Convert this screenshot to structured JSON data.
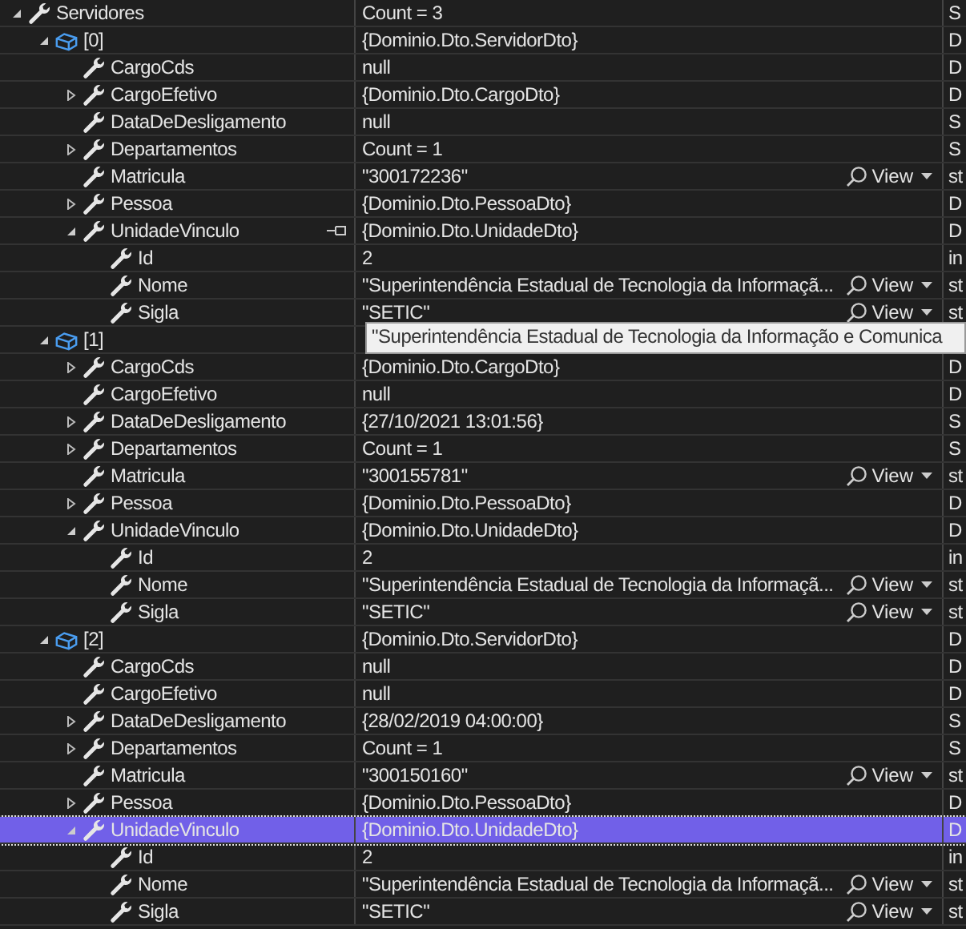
{
  "rows": [
    {
      "name": "Servidores",
      "kind": "property",
      "expanded": true,
      "selected": false,
      "value": "Count = 3",
      "type": "S",
      "children": [
        {
          "name": "[0]",
          "kind": "object",
          "expanded": true,
          "selected": false,
          "value": "{Dominio.Dto.ServidorDto}",
          "type": "D",
          "children": [
            {
              "name": "CargoCds",
              "kind": "property",
              "selected": false,
              "value": "null",
              "type": "D"
            },
            {
              "name": "CargoEfetivo",
              "kind": "property",
              "expanded": false,
              "selected": false,
              "value": "{Dominio.Dto.CargoDto}",
              "type": "D"
            },
            {
              "name": "DataDeDesligamento",
              "kind": "property",
              "selected": false,
              "value": "null",
              "type": "S"
            },
            {
              "name": "Departamentos",
              "kind": "property",
              "expanded": false,
              "selected": false,
              "value": "Count = 1",
              "type": "S"
            },
            {
              "name": "Matricula",
              "kind": "property",
              "selected": false,
              "value": "\"300172236\"",
              "view": "View",
              "type": "st"
            },
            {
              "name": "Pessoa",
              "kind": "property",
              "expanded": false,
              "selected": false,
              "value": "{Dominio.Dto.PessoaDto}",
              "type": "D"
            },
            {
              "name": "UnidadeVinculo",
              "kind": "property",
              "expanded": true,
              "pinned": true,
              "selected": false,
              "value": "{Dominio.Dto.UnidadeDto}",
              "type": "D",
              "children": [
                {
                  "name": "Id",
                  "kind": "property",
                  "selected": false,
                  "value": "2",
                  "type": "in"
                },
                {
                  "name": "Nome",
                  "kind": "property",
                  "selected": false,
                  "value": "\"Superintendência Estadual de Tecnologia da Informaçã...",
                  "view": "View",
                  "type": "st"
                },
                {
                  "name": "Sigla",
                  "kind": "property",
                  "selected": false,
                  "value": "\"SETIC\"",
                  "view": "View",
                  "type": "st"
                }
              ]
            }
          ]
        },
        {
          "name": "[1]",
          "kind": "object",
          "expanded": true,
          "selected": false,
          "children": [
            {
              "name": "CargoCds",
              "kind": "property",
              "expanded": false,
              "selected": false,
              "value": "{Dominio.Dto.CargoDto}",
              "type": "D"
            },
            {
              "name": "CargoEfetivo",
              "kind": "property",
              "selected": false,
              "value": "null",
              "type": "D"
            },
            {
              "name": "DataDeDesligamento",
              "kind": "property",
              "expanded": false,
              "selected": false,
              "value": "{27/10/2021 13:01:56}",
              "type": "S"
            },
            {
              "name": "Departamentos",
              "kind": "property",
              "expanded": false,
              "selected": false,
              "value": "Count = 1",
              "type": "S"
            },
            {
              "name": "Matricula",
              "kind": "property",
              "selected": false,
              "value": "\"300155781\"",
              "view": "View",
              "type": "st"
            },
            {
              "name": "Pessoa",
              "kind": "property",
              "expanded": false,
              "selected": false,
              "value": "{Dominio.Dto.PessoaDto}",
              "type": "D"
            },
            {
              "name": "UnidadeVinculo",
              "kind": "property",
              "expanded": true,
              "selected": false,
              "value": "{Dominio.Dto.UnidadeDto}",
              "type": "D",
              "children": [
                {
                  "name": "Id",
                  "kind": "property",
                  "selected": false,
                  "value": "2",
                  "type": "in"
                },
                {
                  "name": "Nome",
                  "kind": "property",
                  "selected": false,
                  "value": "\"Superintendência Estadual de Tecnologia da Informaçã...",
                  "view": "View",
                  "type": "st"
                },
                {
                  "name": "Sigla",
                  "kind": "property",
                  "selected": false,
                  "value": "\"SETIC\"",
                  "view": "View",
                  "type": "st"
                }
              ]
            }
          ]
        },
        {
          "name": "[2]",
          "kind": "object",
          "expanded": true,
          "selected": false,
          "value": "{Dominio.Dto.ServidorDto}",
          "type": "D",
          "children": [
            {
              "name": "CargoCds",
              "kind": "property",
              "selected": false,
              "value": "null",
              "type": "D"
            },
            {
              "name": "CargoEfetivo",
              "kind": "property",
              "selected": false,
              "value": "null",
              "type": "D"
            },
            {
              "name": "DataDeDesligamento",
              "kind": "property",
              "expanded": false,
              "selected": false,
              "value": "{28/02/2019 04:00:00}",
              "type": "S"
            },
            {
              "name": "Departamentos",
              "kind": "property",
              "expanded": false,
              "selected": false,
              "value": "Count = 1",
              "type": "S"
            },
            {
              "name": "Matricula",
              "kind": "property",
              "selected": false,
              "value": "\"300150160\"",
              "view": "View",
              "type": "st"
            },
            {
              "name": "Pessoa",
              "kind": "property",
              "expanded": false,
              "selected": false,
              "value": "{Dominio.Dto.PessoaDto}",
              "type": "D"
            },
            {
              "name": "UnidadeVinculo",
              "kind": "property",
              "expanded": true,
              "selected": true,
              "value": "{Dominio.Dto.UnidadeDto}",
              "type": "D",
              "children": [
                {
                  "name": "Id",
                  "kind": "property",
                  "selected": false,
                  "value": "2",
                  "type": "in"
                },
                {
                  "name": "Nome",
                  "kind": "property",
                  "selected": false,
                  "value": "\"Superintendência Estadual de Tecnologia da Informaçã...",
                  "view": "View",
                  "type": "st"
                },
                {
                  "name": "Sigla",
                  "kind": "property",
                  "selected": false,
                  "value": "\"SETIC\"",
                  "view": "View",
                  "type": "st"
                }
              ]
            }
          ]
        }
      ]
    }
  ],
  "tooltip": {
    "text": "\"Superintendência Estadual de Tecnologia da Informação e Comunica"
  }
}
